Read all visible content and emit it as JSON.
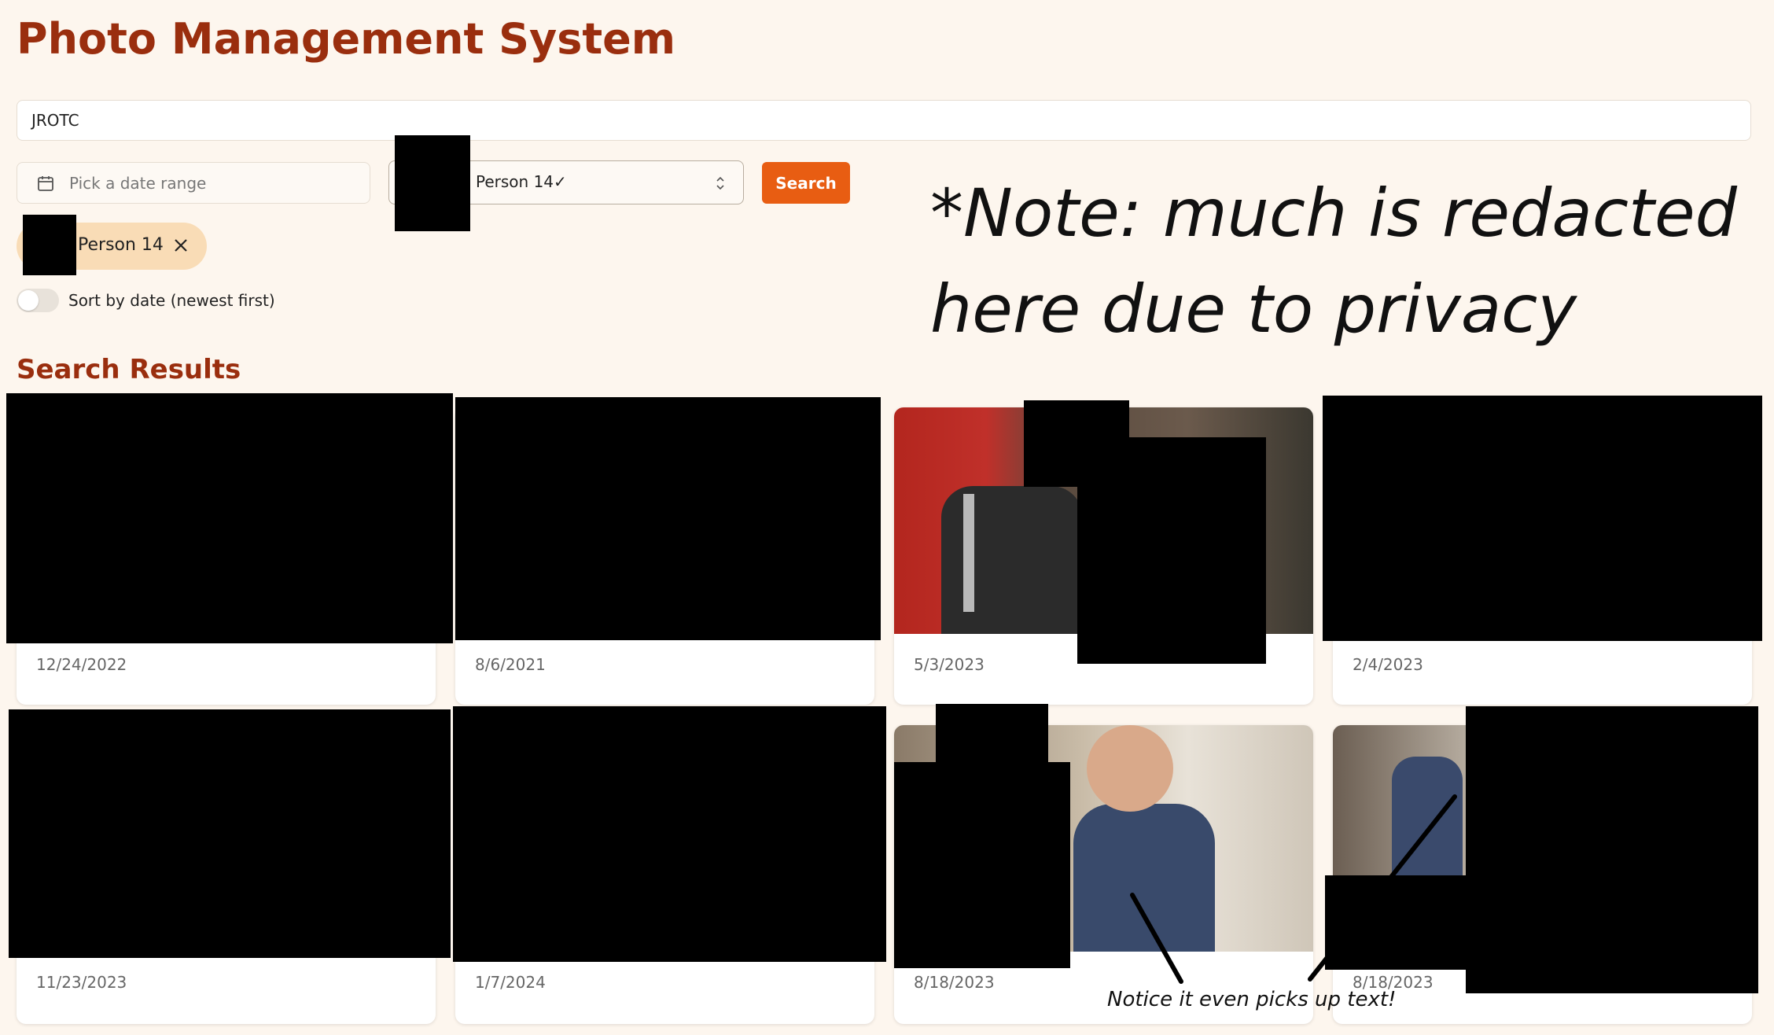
{
  "app": {
    "title": "Photo Management System"
  },
  "search": {
    "query": "JROTC"
  },
  "filters": {
    "date_range_placeholder": "Pick a date range",
    "person_select_value": "Person 14✓",
    "search_button_label": "Search",
    "selected_person_chip": "Person 14",
    "sort_toggle_label": "Sort by date (newest first)",
    "sort_toggle_on": false
  },
  "results": {
    "heading": "Search Results",
    "items": [
      {
        "date": "12/24/2022"
      },
      {
        "date": "8/6/2021"
      },
      {
        "date": "5/3/2023"
      },
      {
        "date": "2/4/2023"
      },
      {
        "date": "11/23/2023"
      },
      {
        "date": "1/7/2024"
      },
      {
        "date": "8/18/2023"
      },
      {
        "date": "8/18/2023"
      }
    ]
  },
  "annotations": {
    "note_line1": "*Note: much is redacted",
    "note_line2": "here due to privacy",
    "picks_up_text": "Notice it even picks up text!"
  },
  "colors": {
    "accent": "#e85d12",
    "heading": "#9a2e0e",
    "background": "#fdf6ee",
    "chip": "#f9dcb6"
  }
}
